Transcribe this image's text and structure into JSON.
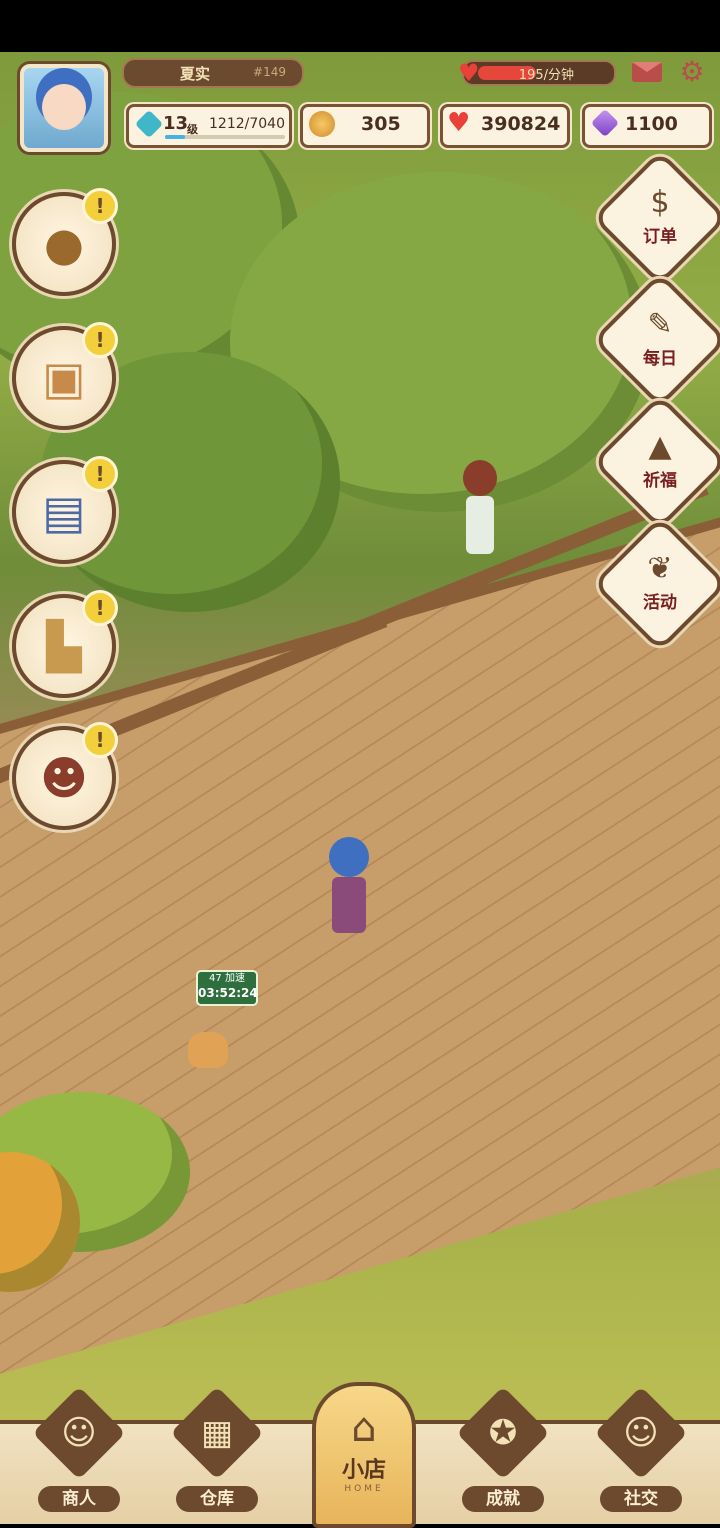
{
  "player": {
    "name": "夏实",
    "id_tag": "#149",
    "level": "13",
    "level_unit": "级",
    "exp": "1212/7040",
    "exp_fraction": 0.17
  },
  "energy": {
    "rate_text": "195/分钟",
    "fill_fraction": 0.48
  },
  "resources": {
    "coins": "305",
    "hearts": "390824",
    "gems": "1100"
  },
  "left_menu": [
    {
      "icon": "mushroom-icon",
      "alert": "!"
    },
    {
      "icon": "tv-icon",
      "alert": "!"
    },
    {
      "icon": "machine-icon",
      "alert": "!"
    },
    {
      "icon": "armchair-icon",
      "alert": "!"
    },
    {
      "icon": "girl-portrait-icon",
      "alert": "!"
    }
  ],
  "right_menu": [
    {
      "icon": "order-book-icon",
      "label": "订单"
    },
    {
      "icon": "daily-notebook-icon",
      "label": "每日"
    },
    {
      "icon": "prayer-icon",
      "label": "祈福"
    },
    {
      "icon": "event-speech-icon",
      "label": "活动"
    }
  ],
  "table_timer": {
    "line1": "47 加速",
    "line2": "03:52:24"
  },
  "bottom_nav": {
    "merchant": "商人",
    "warehouse": "仓库",
    "home_label": "小店",
    "home_sub": "HOME",
    "achievement": "成就",
    "social": "社交"
  },
  "colors": {
    "accent": "#6d4a2e",
    "alert": "#f4cf3c",
    "heart": "#e8413a"
  }
}
